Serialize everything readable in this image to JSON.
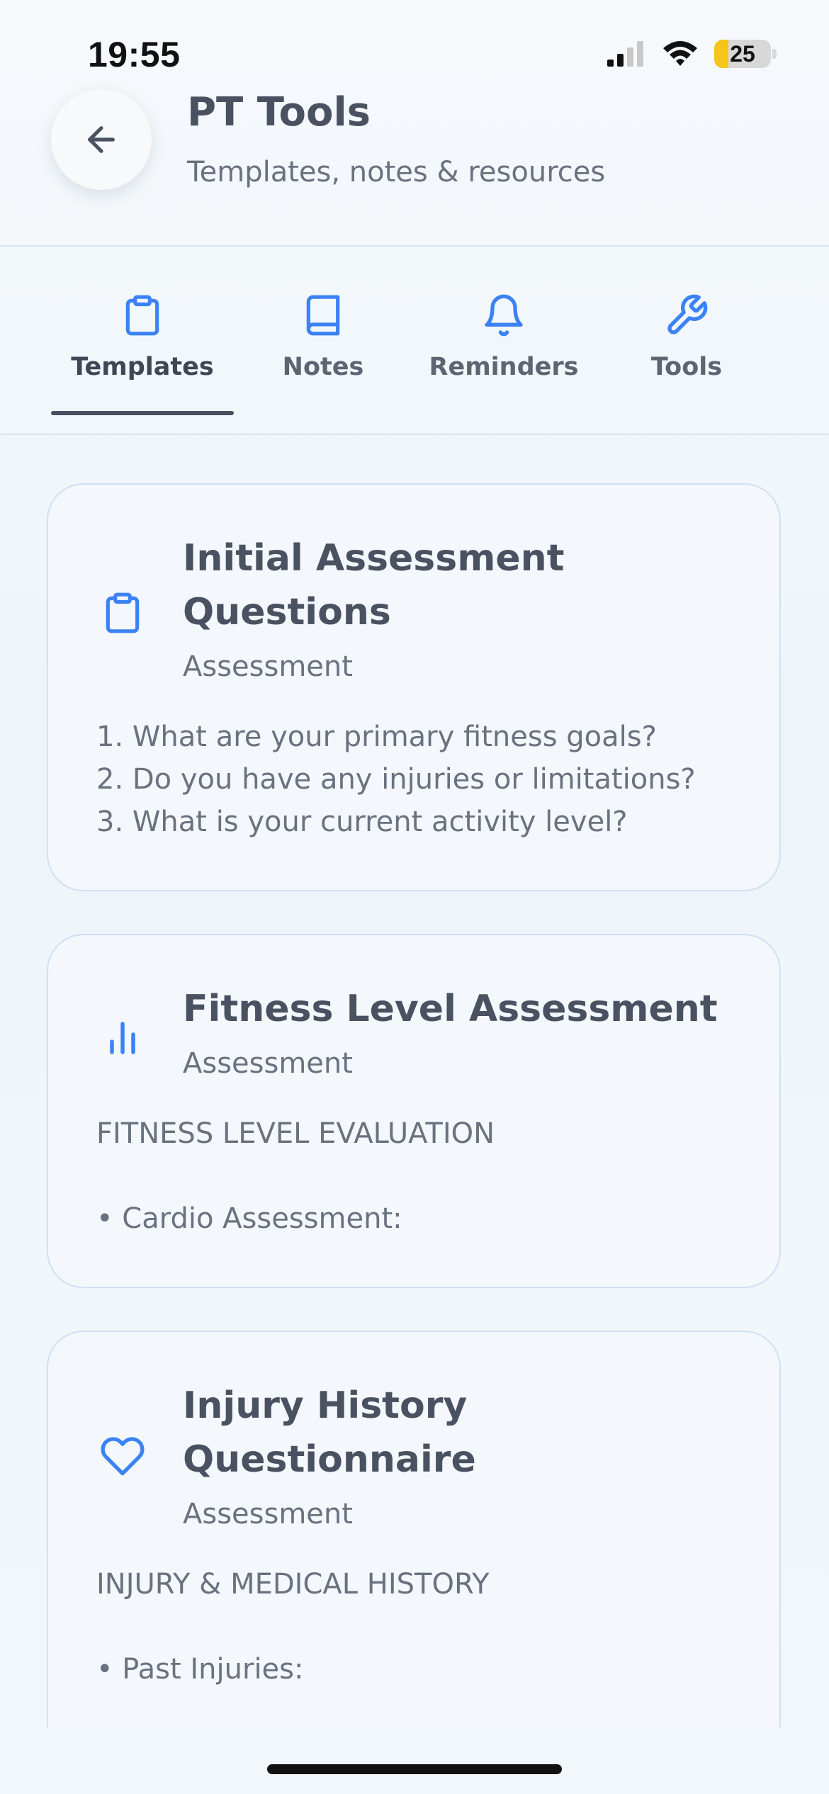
{
  "status_bar": {
    "time": "19:55",
    "battery": "25",
    "battery_level_percent": 25,
    "signal_bars_active": 2,
    "signal_bars_total": 4
  },
  "header": {
    "title": "PT Tools",
    "subtitle": "Templates, notes & resources",
    "back_icon": "arrow-left-icon"
  },
  "tabs": [
    {
      "label": "Templates",
      "icon": "clipboard-icon",
      "active": true
    },
    {
      "label": "Notes",
      "icon": "book-icon",
      "active": false
    },
    {
      "label": "Reminders",
      "icon": "bell-icon",
      "active": false
    },
    {
      "label": "Tools",
      "icon": "wrench-icon",
      "active": false
    }
  ],
  "cards": [
    {
      "title": "Initial Assessment Questions",
      "category": "Assessment",
      "icon": "clipboard-icon",
      "body": "1. What are your primary fitness goals?\n2. Do you have any injuries or limitations?\n3. What is your current activity level?"
    },
    {
      "title": "Fitness Level Assessment",
      "category": "Assessment",
      "icon": "bar-chart-icon",
      "body": "FITNESS LEVEL EVALUATION\n\n• Cardio Assessment:"
    },
    {
      "title": "Injury History Questionnaire",
      "category": "Assessment",
      "icon": "heart-icon",
      "body": "INJURY & MEDICAL HISTORY\n\n• Past Injuries:"
    }
  ],
  "colors": {
    "accent": "#3b82f6",
    "text_primary": "#4a5261",
    "text_secondary": "#6a7280",
    "card_border": "#cfe0f5"
  }
}
